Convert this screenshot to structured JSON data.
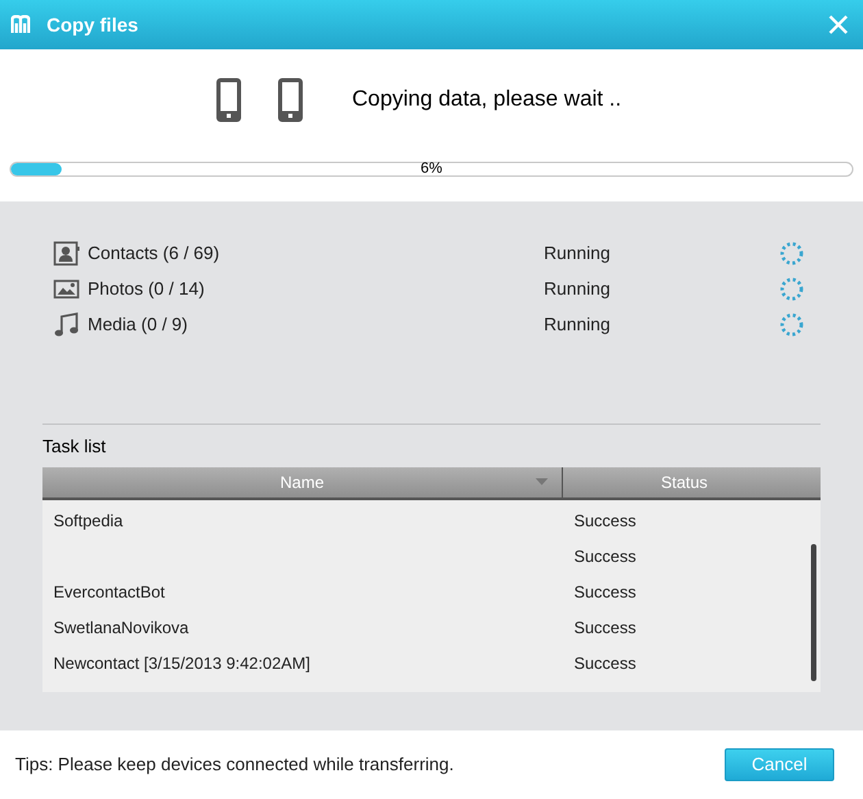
{
  "window": {
    "title": "Copy files"
  },
  "header": {
    "message": "Copying data, please wait ..",
    "progress": {
      "level": 0.06,
      "label": "6%"
    }
  },
  "items": [
    {
      "kind": "contacts",
      "label": "Contacts (6 / 69)",
      "status": "Running"
    },
    {
      "kind": "photos",
      "label": "Photos (0 / 14)",
      "status": "Running"
    },
    {
      "kind": "media",
      "label": "Media (0 / 9)",
      "status": "Running"
    }
  ],
  "task_list": {
    "title": "Task list",
    "columns": [
      "Name",
      "Status"
    ],
    "rows": [
      {
        "name": "Softpedia",
        "status": "Success"
      },
      {
        "status": "Success"
      },
      {
        "name": "EvercontactBot",
        "status": "Success"
      },
      {
        "name": "SwetlanaNovikova",
        "status": "Success"
      },
      {
        "name": "Newcontact [3/15/2013 9:42:02AM]",
        "status": "Success"
      }
    ]
  },
  "footer": {
    "tip": "Tips: Please keep devices connected while transferring.",
    "button": "Cancel"
  }
}
